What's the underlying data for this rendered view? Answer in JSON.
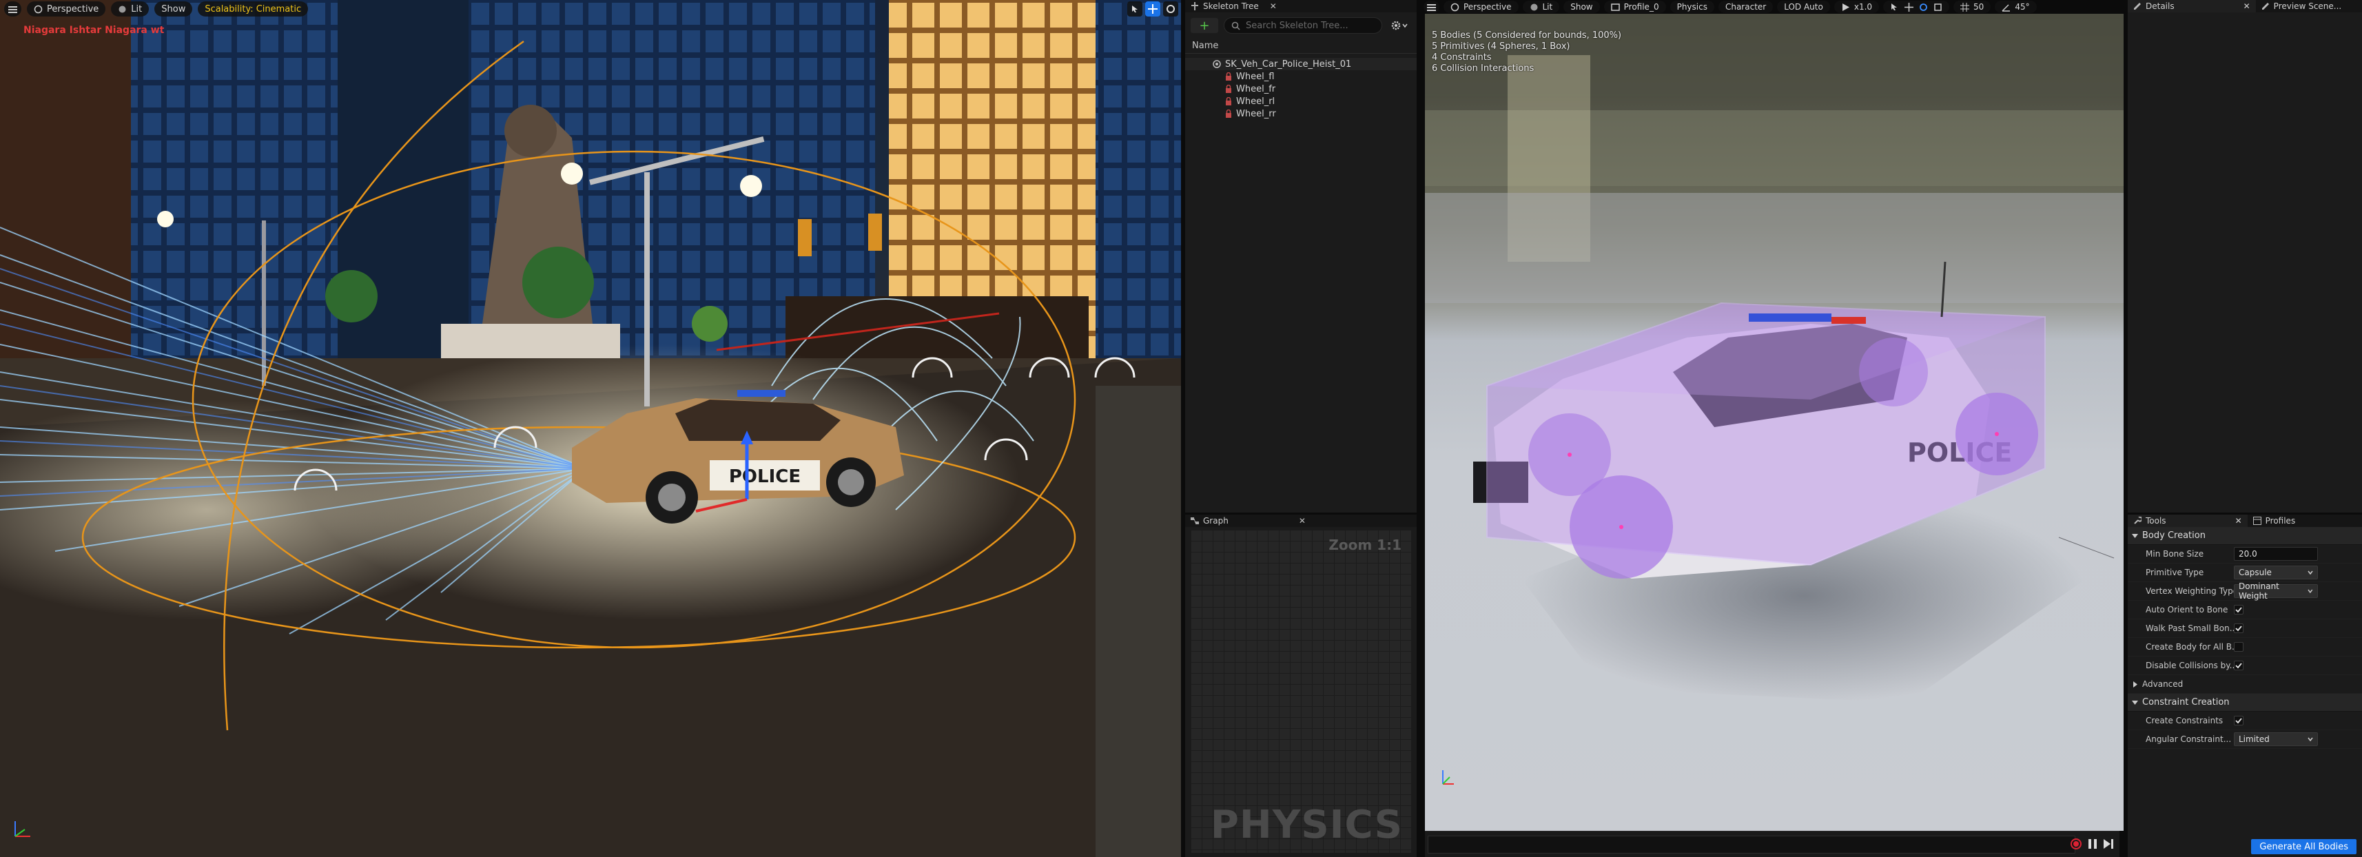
{
  "left_viewport": {
    "perspective": "Perspective",
    "lit": "Lit",
    "show": "Show",
    "scalability": "Scalability: Cinematic",
    "warning": "Niagara Ishtar Niagara wt",
    "police_label": "POLICE"
  },
  "skeleton_tree": {
    "tab": "Skeleton Tree",
    "search_placeholder": "Search Skeleton Tree...",
    "column": "Name",
    "root": "SK_Veh_Car_Police_Heist_01",
    "bones": [
      "Wheel_fl",
      "Wheel_fr",
      "Wheel_rl",
      "Wheel_rr"
    ]
  },
  "graph": {
    "tab": "Graph",
    "zoom": "Zoom 1:1",
    "watermark": "PHYSICS"
  },
  "right_viewport": {
    "perspective": "Perspective",
    "lit": "Lit",
    "show": "Show",
    "profile": "Profile_0",
    "physics": "Physics",
    "character": "Character",
    "lod": "LOD Auto",
    "speed": "x1.0",
    "grid_num": "50",
    "angle": "45°",
    "stats": [
      "5 Bodies (5 Considered for bounds, 100%)",
      "5 Primitives  (4 Spheres, 1 Box)",
      "4 Constraints",
      "6 Collision Interactions"
    ],
    "police_label": "POLICE"
  },
  "details": {
    "tab": "Details",
    "tab2": "Preview Scene..."
  },
  "tools": {
    "tab": "Tools",
    "tab2": "Profiles",
    "body_creation": "Body Creation",
    "min_bone_size_label": "Min Bone Size",
    "min_bone_size": "20.0",
    "primitive_type_label": "Primitive Type",
    "primitive_type": "Capsule",
    "vertex_weighting_label": "Vertex Weighting Type",
    "vertex_weighting": "Dominant Weight",
    "auto_orient_label": "Auto Orient to Bone",
    "walk_past_label": "Walk Past Small Bon...",
    "create_body_label": "Create Body for All B...",
    "disable_collisions_label": "Disable Collisions by...",
    "advanced": "Advanced",
    "constraint_creation": "Constraint Creation",
    "create_constraints_label": "Create Constraints",
    "angular_constraint_label": "Angular Constraint...",
    "angular_constraint": "Limited",
    "checks": {
      "auto_orient": true,
      "walk_past": true,
      "create_body": false,
      "disable_collisions": true,
      "create_constraints": true
    },
    "generate_button": "Generate All Bodies"
  },
  "colors": {
    "accent": "#1a73e8",
    "scalability": "#f0c419",
    "warning": "#e53b3b",
    "physics_body": "#b88be8"
  }
}
